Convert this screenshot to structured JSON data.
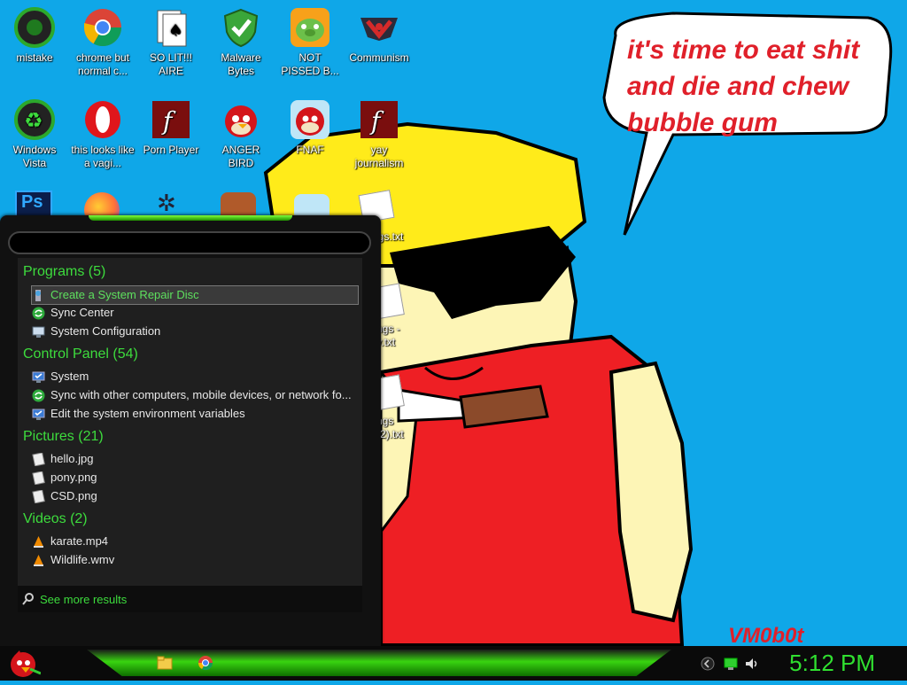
{
  "desktop": {
    "icons": [
      {
        "label": "mistake",
        "icon": "green-circle-icon"
      },
      {
        "label": "chrome but normal c...",
        "icon": "chrome-icon"
      },
      {
        "label": "SO LIT!!! AIRE",
        "icon": "cards-icon"
      },
      {
        "label": "Malware Bytes",
        "icon": "shield-icon"
      },
      {
        "label": "NOT PISSED B...",
        "icon": "bad-piggies-icon"
      },
      {
        "label": "Communism",
        "icon": "emblem-icon"
      },
      {
        "label": "Windows Vista",
        "icon": "recycle-icon"
      },
      {
        "label": "this looks like a vagi...",
        "icon": "opera-icon"
      },
      {
        "label": "Porn Player",
        "icon": "flash-icon"
      },
      {
        "label": "ANGER BIRD",
        "icon": "angry-bird-icon"
      },
      {
        "label": "FNAF",
        "icon": "angry-bird-icon"
      },
      {
        "label": "yay journalism",
        "icon": "flash-icon"
      }
    ],
    "partial_labels": [
      "ngs.txt",
      "ngs -",
      "y.txt",
      "ngs",
      "(2).txt"
    ]
  },
  "wallpaper": {
    "speech_bubble": "it's time to eat shit and die and chew bubble gum",
    "signature": "VM0b0t"
  },
  "start_menu": {
    "categories": [
      {
        "title": "Programs (5)",
        "items": [
          {
            "label": "Create a System Repair Disc",
            "selected": true
          },
          {
            "label": "Sync Center"
          },
          {
            "label": "System Configuration"
          }
        ]
      },
      {
        "title": "Control Panel (54)",
        "items": [
          {
            "label": "System"
          },
          {
            "label": "Sync with other computers, mobile devices, or network fo..."
          },
          {
            "label": "Edit the system environment variables"
          }
        ]
      },
      {
        "title": "Pictures (21)",
        "items": [
          {
            "label": "hello.jpg"
          },
          {
            "label": "pony.png"
          },
          {
            "label": "CSD.png"
          }
        ]
      },
      {
        "title": "Videos (2)",
        "items": [
          {
            "label": "karate.mp4"
          },
          {
            "label": "Wildlife.wmv"
          }
        ]
      }
    ],
    "see_more": "See more results"
  },
  "taskbar": {
    "clock": "5:12 PM",
    "pinned": [
      "explorer-icon",
      "chrome-icon"
    ],
    "tray": [
      "chevron-left-icon",
      "network-icon",
      "volume-icon"
    ]
  },
  "colors": {
    "accent": "#3ddc3d",
    "desktop": "#0fa7e8",
    "bubble_text": "#e0202a"
  }
}
